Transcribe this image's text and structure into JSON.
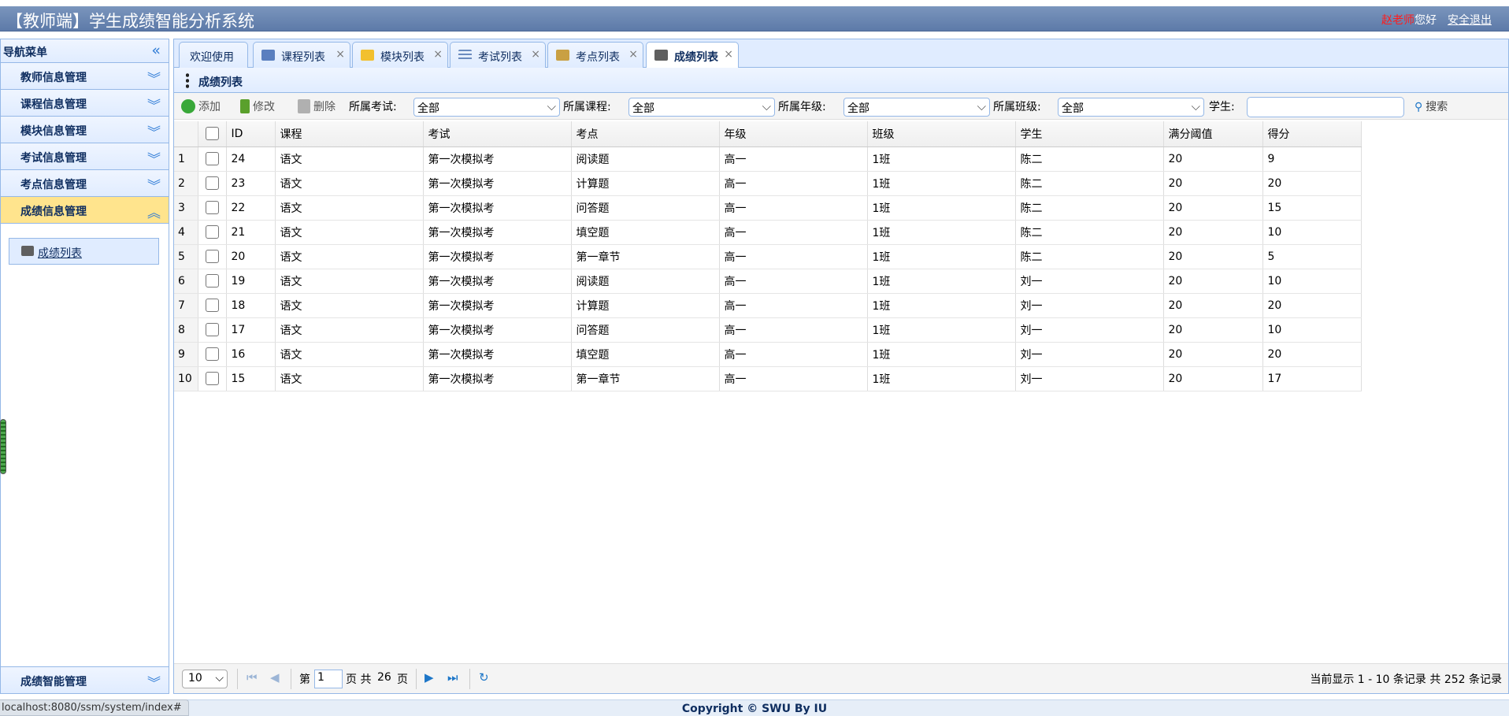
{
  "header": {
    "title": "【教师端】学生成绩智能分析系统",
    "user": "赵老师",
    "greeting": "您好",
    "logout": "安全退出"
  },
  "sidebar": {
    "title": "导航菜单",
    "items": [
      {
        "label": "教师信息管理"
      },
      {
        "label": "课程信息管理"
      },
      {
        "label": "模块信息管理"
      },
      {
        "label": "考试信息管理"
      },
      {
        "label": "考点信息管理"
      },
      {
        "label": "成绩信息管理"
      }
    ],
    "sub_link": "成绩列表",
    "bottom_item": "成绩智能管理"
  },
  "tabs": [
    {
      "label": "欢迎使用"
    },
    {
      "label": "课程列表"
    },
    {
      "label": "模块列表"
    },
    {
      "label": "考试列表"
    },
    {
      "label": "考点列表"
    },
    {
      "label": "成绩列表"
    }
  ],
  "tab_close": "×",
  "panel": {
    "title": "成绩列表"
  },
  "toolbar": {
    "add": "添加",
    "edit": "修改",
    "delete": "删除",
    "exam_label": "所属考试:",
    "exam_value": "全部",
    "course_label": "所属课程:",
    "course_value": "全部",
    "grade_label": "所属年级:",
    "grade_value": "全部",
    "class_label": "所属班级:",
    "class_value": "全部",
    "student_label": "学生:",
    "search": "搜索"
  },
  "table": {
    "columns": [
      "ID",
      "课程",
      "考试",
      "考点",
      "年级",
      "班级",
      "学生",
      "满分阈值",
      "得分"
    ],
    "rows": [
      [
        "1",
        "24",
        "语文",
        "第一次模拟考",
        "阅读题",
        "高一",
        "1班",
        "陈二",
        "20",
        "9"
      ],
      [
        "2",
        "23",
        "语文",
        "第一次模拟考",
        "计算题",
        "高一",
        "1班",
        "陈二",
        "20",
        "20"
      ],
      [
        "3",
        "22",
        "语文",
        "第一次模拟考",
        "问答题",
        "高一",
        "1班",
        "陈二",
        "20",
        "15"
      ],
      [
        "4",
        "21",
        "语文",
        "第一次模拟考",
        "填空题",
        "高一",
        "1班",
        "陈二",
        "20",
        "10"
      ],
      [
        "5",
        "20",
        "语文",
        "第一次模拟考",
        "第一章节",
        "高一",
        "1班",
        "陈二",
        "20",
        "5"
      ],
      [
        "6",
        "19",
        "语文",
        "第一次模拟考",
        "阅读题",
        "高一",
        "1班",
        "刘一",
        "20",
        "10"
      ],
      [
        "7",
        "18",
        "语文",
        "第一次模拟考",
        "计算题",
        "高一",
        "1班",
        "刘一",
        "20",
        "20"
      ],
      [
        "8",
        "17",
        "语文",
        "第一次模拟考",
        "问答题",
        "高一",
        "1班",
        "刘一",
        "20",
        "10"
      ],
      [
        "9",
        "16",
        "语文",
        "第一次模拟考",
        "填空题",
        "高一",
        "1班",
        "刘一",
        "20",
        "20"
      ],
      [
        "10",
        "15",
        "语文",
        "第一次模拟考",
        "第一章节",
        "高一",
        "1班",
        "刘一",
        "20",
        "17"
      ]
    ]
  },
  "pager": {
    "page_size": "10",
    "page_prefix": "第",
    "current_page": "1",
    "page_mid": "页 共",
    "total_pages": "26",
    "page_suffix": "页",
    "info": "当前显示 1 - 10 条记录 共 252 条记录"
  },
  "footer": {
    "url": "localhost:8080/ssm/system/index#",
    "copyright": "Copyright © SWU By IU"
  },
  "colors": {
    "accent": "#95b8e7",
    "active_menu": "#ffe48d",
    "user_name": "#ff1c1c",
    "title_text": "#0e2d5f"
  }
}
